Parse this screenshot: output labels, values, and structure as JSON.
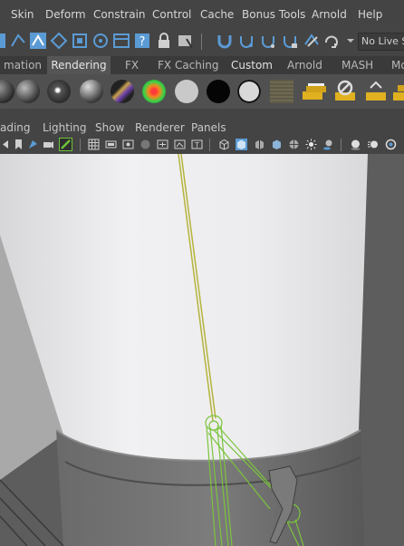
{
  "menubar": {
    "items": [
      "Skin",
      "Deform",
      "Constrain",
      "Control",
      "Cache",
      "Bonus Tools",
      "Arnold",
      "Help"
    ]
  },
  "statusline": {
    "live_surface": "No Live S"
  },
  "shelf_tabs": {
    "items": [
      "mation",
      "Rendering",
      "FX",
      "FX Caching",
      "Custom",
      "Arnold",
      "MASH",
      "Mo"
    ],
    "active": "Rendering"
  },
  "panel_menu": {
    "items": [
      "ading",
      "Lighting",
      "Show",
      "Renderer",
      "Panels"
    ]
  },
  "colors": {
    "ui_bg": "#444444",
    "shelf_bg": "#505050",
    "viewport_bg": "#5d5d5d",
    "wire_green": "#7bc43c",
    "wire_yellow": "#b5b33c",
    "active_blue": "#5b9bd5"
  },
  "icons": [
    "magnet-icon",
    "snap-curve-icon",
    "snap-point-icon",
    "lock-icon",
    "lasso-icon",
    "redo-icon",
    "render-icon",
    "ipr-icon",
    "grid-icon",
    "wireframe-icon",
    "light-icon",
    "camera-icon"
  ]
}
